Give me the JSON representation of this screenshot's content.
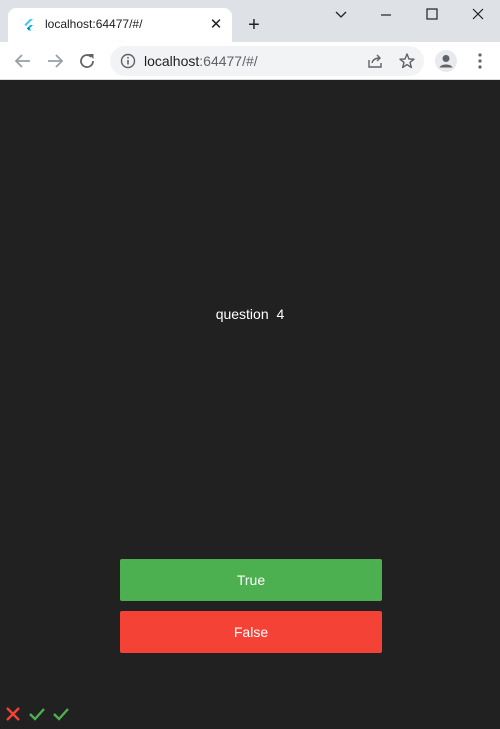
{
  "browser": {
    "tab": {
      "title": "localhost:64477/#/",
      "favicon": "flutter-icon"
    },
    "address_bar": {
      "host": "localhost",
      "rest": ":64477/#/"
    }
  },
  "app": {
    "question_text": "question  4",
    "buttons": {
      "true_label": "True",
      "false_label": "False"
    },
    "score_keeper": [
      {
        "icon": "close-icon",
        "result": "wrong"
      },
      {
        "icon": "check-icon",
        "result": "correct"
      },
      {
        "icon": "check-icon",
        "result": "correct"
      }
    ]
  },
  "colors": {
    "background": "#212121",
    "true_button": "#4caf50",
    "false_button": "#f44336",
    "wrong_icon": "#f44336",
    "correct_icon": "#4caf50"
  }
}
